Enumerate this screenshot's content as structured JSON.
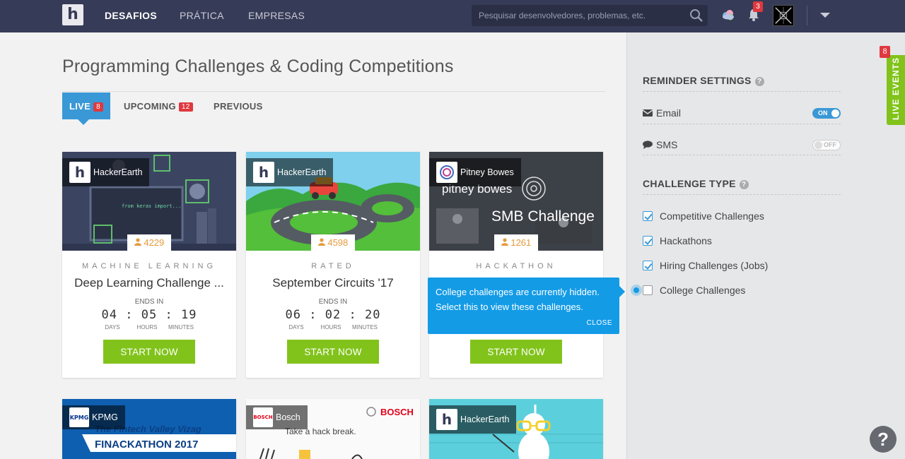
{
  "nav": {
    "logo_letter": "h",
    "links": [
      "DESAFIOS",
      "PRÁTICA",
      "EMPRESAS"
    ],
    "search_placeholder": "Pesquisar desenvolvedores, problemas, etc.",
    "notification_count": "3",
    "icons": [
      "search-icon",
      "cloud-icon",
      "bell-icon",
      "chevron-down-icon"
    ]
  },
  "page": {
    "title": "Programming Challenges & Coding Competitions",
    "tabs": [
      {
        "label": "LIVE",
        "count": "8",
        "active": true
      },
      {
        "label": "UPCOMING",
        "count": "12"
      },
      {
        "label": "PREVIOUS"
      }
    ]
  },
  "cards": [
    {
      "org": "HackerEarth",
      "registrations": "4229",
      "type": "MACHINE LEARNING",
      "name": "Deep Learning Challenge ...",
      "ends_label": "ENDS IN",
      "timer": {
        "days": "04",
        "hours": "05",
        "minutes": "19"
      },
      "image_text": "from keras import...",
      "button": "START NOW"
    },
    {
      "org": "HackerEarth",
      "registrations": "4598",
      "type": "RATED",
      "name": "September Circuits '17",
      "ends_label": "ENDS IN",
      "timer": {
        "days": "06",
        "hours": "02",
        "minutes": "20"
      },
      "button": "START NOW"
    },
    {
      "org": "Pitney Bowes",
      "registrations": "1261",
      "type": "HACKATHON",
      "name": "",
      "image_text": [
        "pitney bowes",
        "SMB Challenge"
      ],
      "button": "START NOW"
    },
    {
      "org": "KPMG",
      "image_text": [
        "The Fintech Valley Vizag",
        "FINACKATHON 2017"
      ]
    },
    {
      "org": "Bosch",
      "image_text": [
        "BOSCH",
        "Take a hack break."
      ]
    },
    {
      "org": "HackerEarth"
    }
  ],
  "timer_units": [
    "DAYS",
    "HOURS",
    "MINUTES"
  ],
  "tooltip": {
    "text": "College challenges are currently hidden. Select this to view these challenges.",
    "close": "CLOSE"
  },
  "sidebar": {
    "reminder_title": "REMINDER SETTINGS",
    "email_label": "Email",
    "email_state": "ON",
    "sms_label": "SMS",
    "sms_state": "OFF",
    "challenge_type_title": "CHALLENGE TYPE",
    "filters": [
      {
        "label": "Competitive Challenges",
        "checked": true
      },
      {
        "label": "Hackathons",
        "checked": true
      },
      {
        "label": "Hiring Challenges (Jobs)",
        "checked": true
      },
      {
        "label": "College Challenges",
        "checked": false
      }
    ]
  },
  "live_events": {
    "label": "LIVE EVENTS",
    "count": "8"
  },
  "help_fab": "?",
  "colors": {
    "nav_bg": "#363b57",
    "accent_blue": "#3a98d6",
    "start_green": "#81c31b",
    "badge_red": "#e0383e",
    "tooltip_blue": "#139be6"
  }
}
